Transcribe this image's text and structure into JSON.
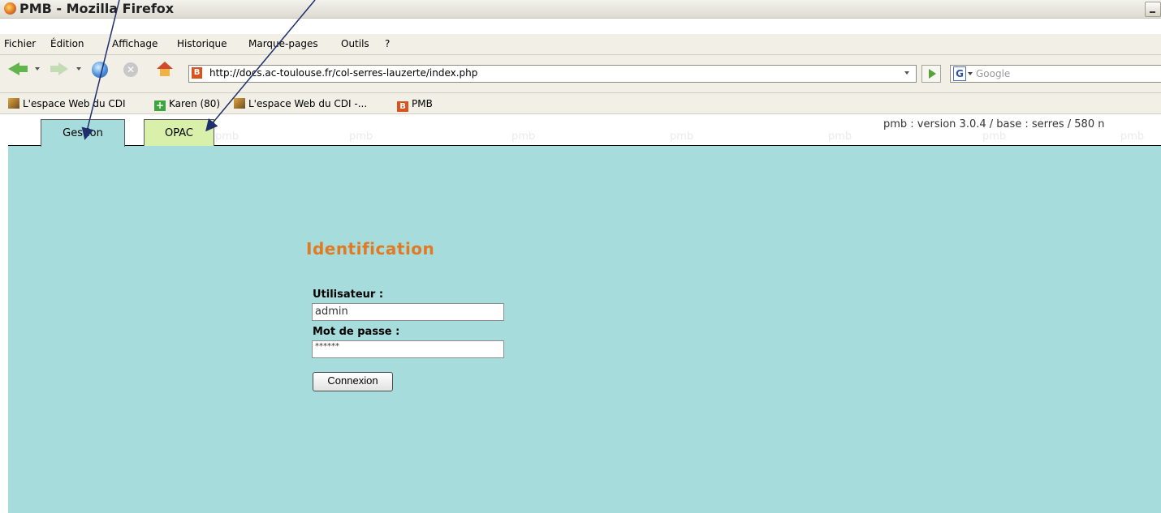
{
  "window": {
    "title": "PMB - Mozilla Firefox"
  },
  "menubar": {
    "items": [
      {
        "label": "Fichier"
      },
      {
        "label": "Édition"
      },
      {
        "label": "Affichage"
      },
      {
        "label": "Historique"
      },
      {
        "label": "Marque-pages"
      },
      {
        "label": "Outils"
      },
      {
        "label": "?"
      }
    ]
  },
  "navbar": {
    "url": "http://docs.ac-toulouse.fr/col-serres-lauzerte/index.php",
    "search_placeholder": "Google",
    "search_engine_icon": "G"
  },
  "bookmarks": [
    {
      "label": "L'espace Web du CDI",
      "icon": "cdi-icon"
    },
    {
      "label": "Karen (80)",
      "icon": "plus-icon"
    },
    {
      "label": "L'espace Web du CDI -...",
      "icon": "cdi-icon"
    },
    {
      "label": "PMB",
      "icon": "pmb-icon"
    }
  ],
  "app": {
    "tabs": [
      {
        "label": "Gestion"
      },
      {
        "label": "OPAC"
      }
    ],
    "watermark": "pmb",
    "version_text": "pmb : version 3.0.4 / base : serres / 580 n",
    "login": {
      "title": "Identification",
      "user_label": "Utilisateur :",
      "user_value": "admin",
      "password_label": "Mot de passe :",
      "password_value": "******",
      "submit_label": "Connexion"
    }
  },
  "colors": {
    "page_background": "#a6dcdc",
    "title_orange": "#e07a23",
    "opac_tab": "#d9f0ab",
    "arrow": "#1f2f6b"
  }
}
